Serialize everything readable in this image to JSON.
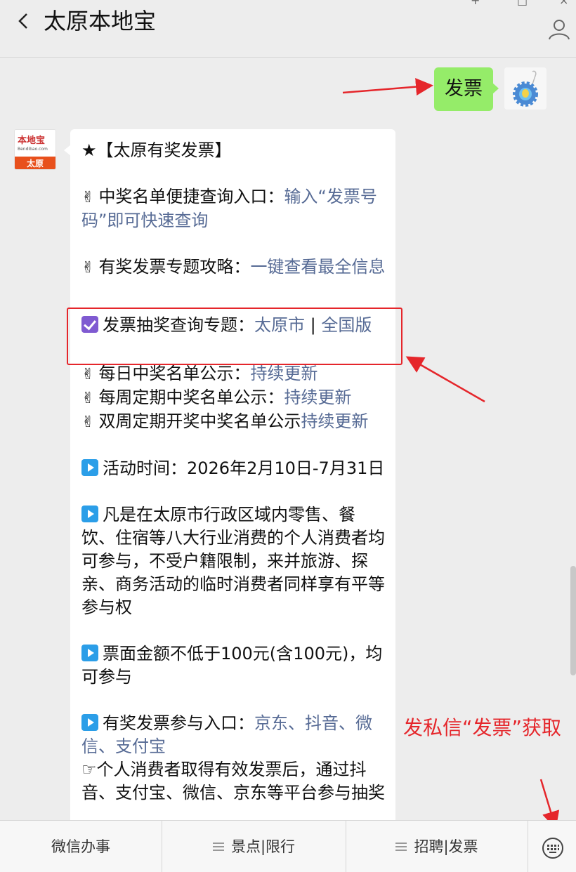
{
  "header": {
    "title": "太原本地宝"
  },
  "outgoing": {
    "text": "发票"
  },
  "incoming": {
    "account_logo": "本地宝",
    "account_url": "Bendibao.com",
    "account_city": "太原",
    "lines": {
      "title": "★【太原有奖发票】",
      "item1_prefix": "中奖名单便捷查询入口：",
      "item1_link": "输入“发票号码”即可快速查询",
      "item2_prefix": "有奖发票专题攻略：",
      "item2_link": "一键查看最全信息",
      "item3_prefix": "发票抽奖查询专题：",
      "item3_link_a": "太原市",
      "item3_sep": " | ",
      "item3_link_b": "全国版",
      "item4_prefix": "每日中奖名单公示：",
      "item4_link": "持续更新",
      "item5_prefix": "每周定期中奖名单公示：",
      "item5_link": "持续更新",
      "item6_prefix": "双周定期开奖中奖名单公示",
      "item6_link": "持续更新",
      "item7": "活动时间：2026年2月10日-7月31日",
      "item8": "凡是在太原市行政区域内零售、餐饮、住宿等八大行业消费的个人消费者均可参与，不受户籍限制，来并旅游、探亲、商务活动的临时消费者同样享有平等参与权",
      "item9": "票面金额不低于100元(含100元)，均可参与",
      "item10_prefix": "有奖发票参与入口：",
      "item10_link": "京东、抖音、微信、支付宝",
      "item11": "☞个人消费者取得有效发票后，通过抖音、支付宝、微信、京东等平台参与抽奖"
    }
  },
  "annotation": {
    "text": "发私信“发票”获取"
  },
  "bottom_menu": {
    "item1": "微信办事",
    "item2": "景点|限行",
    "item3": "招聘|发票"
  },
  "icons": {
    "back": "chevron-left-icon",
    "profile": "person-icon",
    "keyboard": "keyboard-icon",
    "victory": "victory-hand-icon",
    "play": "play-button-icon",
    "check": "checkbox-icon"
  },
  "colors": {
    "outgoing_bubble": "#95ec69",
    "link": "#576b95",
    "annotation_red": "#e5262b"
  }
}
